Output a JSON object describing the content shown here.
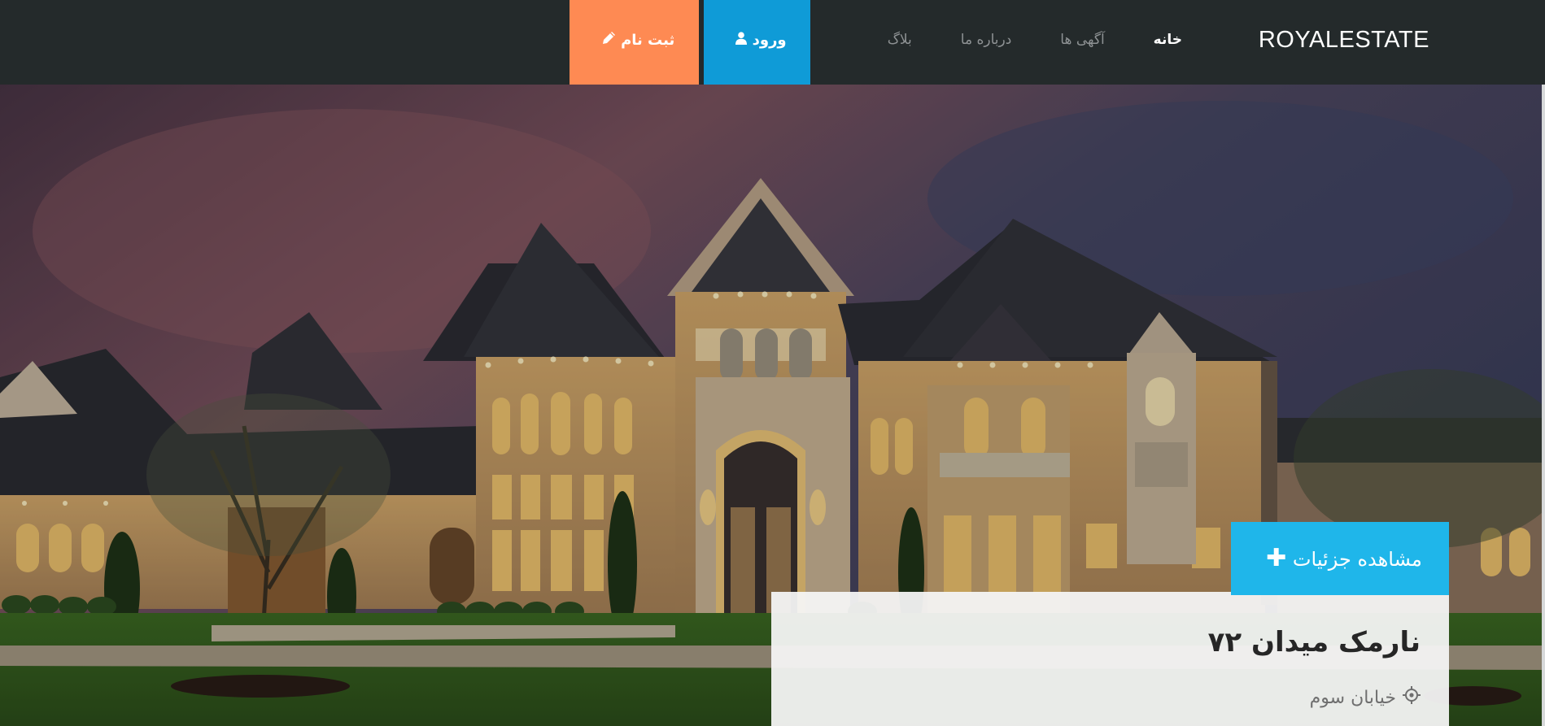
{
  "navbar": {
    "brand": "ROYALESTATE",
    "menu": [
      {
        "label": "خانه",
        "active": true
      },
      {
        "label": "آگهی ها",
        "active": false
      },
      {
        "label": "درباره ما",
        "active": false
      },
      {
        "label": "بلاگ",
        "active": false
      }
    ],
    "login": {
      "label": "ورود",
      "icon": "user-icon",
      "color": "#0f9bd7"
    },
    "register": {
      "label": "ثبت نام",
      "icon": "pencil-icon",
      "color": "#fe8a53"
    }
  },
  "hero": {
    "image": "mansion-at-dusk",
    "details_button": {
      "label": "مشاهده جزئیات",
      "icon": "plus-icon",
      "color": "#1fb6ea"
    },
    "listing": {
      "title": "نارمک میدان ۷۲",
      "address": "خیابان سوم",
      "address_icon": "location-target-icon"
    }
  }
}
